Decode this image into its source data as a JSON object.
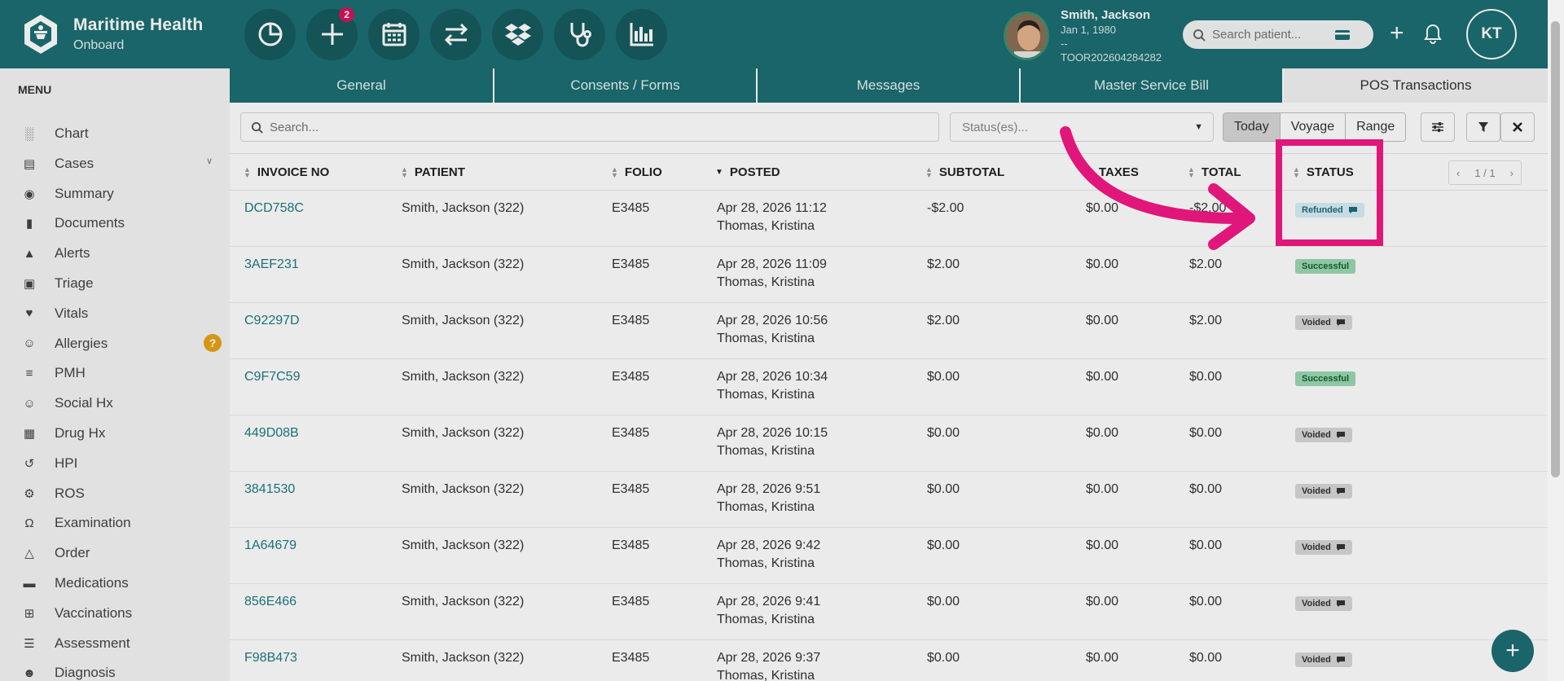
{
  "brand": {
    "title": "Maritime Health",
    "subtitle": "Onboard"
  },
  "toolbar": {
    "badge_count": "2",
    "icons": [
      "pie-chart-icon",
      "add-icon",
      "calendar-icon",
      "swap-icon",
      "dropbox-icon",
      "stethoscope-icon",
      "bar-chart-icon"
    ]
  },
  "patient": {
    "name": "Smith, Jackson",
    "dob": "Jan 1, 1980",
    "line2": "--",
    "id": "TOOR202604284282"
  },
  "search": {
    "placeholder": "Search patient..."
  },
  "user": {
    "initials": "KT"
  },
  "menu": {
    "title": "MENU",
    "items": [
      {
        "label": "Chart",
        "icon": "bar-chart-icon"
      },
      {
        "label": "Cases",
        "icon": "archive-icon"
      },
      {
        "label": "Summary",
        "icon": "eye-icon"
      },
      {
        "label": "Documents",
        "icon": "folder-icon"
      },
      {
        "label": "Alerts",
        "icon": "warning-icon"
      },
      {
        "label": "Triage",
        "icon": "inbox-icon"
      },
      {
        "label": "Vitals",
        "icon": "heart-icon"
      },
      {
        "label": "Allergies",
        "icon": "face-icon"
      },
      {
        "label": "PMH",
        "icon": "sort-list-icon"
      },
      {
        "label": "Social Hx",
        "icon": "smile-icon"
      },
      {
        "label": "Drug Hx",
        "icon": "medkit-icon"
      },
      {
        "label": "HPI",
        "icon": "history-icon"
      },
      {
        "label": "ROS",
        "icon": "gear-icon"
      },
      {
        "label": "Examination",
        "icon": "stethoscope-icon"
      },
      {
        "label": "Order",
        "icon": "flask-icon"
      },
      {
        "label": "Medications",
        "icon": "pill-icon"
      },
      {
        "label": "Vaccinations",
        "icon": "plus-square-icon"
      },
      {
        "label": "Assessment",
        "icon": "list-icon"
      },
      {
        "label": "Diagnosis",
        "icon": "doctor-icon"
      }
    ],
    "allergy_badge": "?"
  },
  "tabs": [
    {
      "label": "General"
    },
    {
      "label": "Consents / Forms"
    },
    {
      "label": "Messages"
    },
    {
      "label": "Master Service Bill"
    },
    {
      "label": "POS Transactions"
    }
  ],
  "filters": {
    "search_placeholder": "Search...",
    "status_placeholder": "Status(es)...",
    "segments": [
      "Today",
      "Voyage",
      "Range"
    ]
  },
  "table": {
    "columns": [
      "INVOICE NO",
      "PATIENT",
      "FOLIO",
      "POSTED",
      "SUBTOTAL",
      "TAXES",
      "TOTAL",
      "STATUS"
    ],
    "pager": "1 / 1",
    "rows": [
      {
        "invoice": "DCD758C",
        "patient": "Smith, Jackson (322)",
        "folio": "E3485",
        "posted": "Apr 28, 2026 11:12",
        "by": "Thomas, Kristina",
        "subtotal": "-$2.00",
        "taxes": "$0.00",
        "total": "-$2.00",
        "status": "Refunded",
        "status_kind": "refunded",
        "comment": true
      },
      {
        "invoice": "3AEF231",
        "patient": "Smith, Jackson (322)",
        "folio": "E3485",
        "posted": "Apr 28, 2026 11:09",
        "by": "Thomas, Kristina",
        "subtotal": "$2.00",
        "taxes": "$0.00",
        "total": "$2.00",
        "status": "Successful",
        "status_kind": "successful",
        "comment": false
      },
      {
        "invoice": "C92297D",
        "patient": "Smith, Jackson (322)",
        "folio": "E3485",
        "posted": "Apr 28, 2026 10:56",
        "by": "Thomas, Kristina",
        "subtotal": "$2.00",
        "taxes": "$0.00",
        "total": "$2.00",
        "status": "Voided",
        "status_kind": "voided",
        "comment": true
      },
      {
        "invoice": "C9F7C59",
        "patient": "Smith, Jackson (322)",
        "folio": "E3485",
        "posted": "Apr 28, 2026 10:34",
        "by": "Thomas, Kristina",
        "subtotal": "$0.00",
        "taxes": "$0.00",
        "total": "$0.00",
        "status": "Successful",
        "status_kind": "successful",
        "comment": false
      },
      {
        "invoice": "449D08B",
        "patient": "Smith, Jackson (322)",
        "folio": "E3485",
        "posted": "Apr 28, 2026 10:15",
        "by": "Thomas, Kristina",
        "subtotal": "$0.00",
        "taxes": "$0.00",
        "total": "$0.00",
        "status": "Voided",
        "status_kind": "voided",
        "comment": true
      },
      {
        "invoice": "3841530",
        "patient": "Smith, Jackson (322)",
        "folio": "E3485",
        "posted": "Apr 28, 2026 9:51",
        "by": "Thomas, Kristina",
        "subtotal": "$0.00",
        "taxes": "$0.00",
        "total": "$0.00",
        "status": "Voided",
        "status_kind": "voided",
        "comment": true
      },
      {
        "invoice": "1A64679",
        "patient": "Smith, Jackson (322)",
        "folio": "E3485",
        "posted": "Apr 28, 2026 9:42",
        "by": "Thomas, Kristina",
        "subtotal": "$0.00",
        "taxes": "$0.00",
        "total": "$0.00",
        "status": "Voided",
        "status_kind": "voided",
        "comment": true
      },
      {
        "invoice": "856E466",
        "patient": "Smith, Jackson (322)",
        "folio": "E3485",
        "posted": "Apr 28, 2026 9:41",
        "by": "Thomas, Kristina",
        "subtotal": "$0.00",
        "taxes": "$0.00",
        "total": "$0.00",
        "status": "Voided",
        "status_kind": "voided",
        "comment": true
      },
      {
        "invoice": "F98B473",
        "patient": "Smith, Jackson (322)",
        "folio": "E3485",
        "posted": "Apr 28, 2026 9:37",
        "by": "Thomas, Kristina",
        "subtotal": "$0.00",
        "taxes": "$0.00",
        "total": "$0.00",
        "status": "Voided",
        "status_kind": "voided",
        "comment": true
      }
    ]
  },
  "colors": {
    "brand": "#1c6e72",
    "highlight": "#e0167a",
    "badge": "#d3145a"
  }
}
